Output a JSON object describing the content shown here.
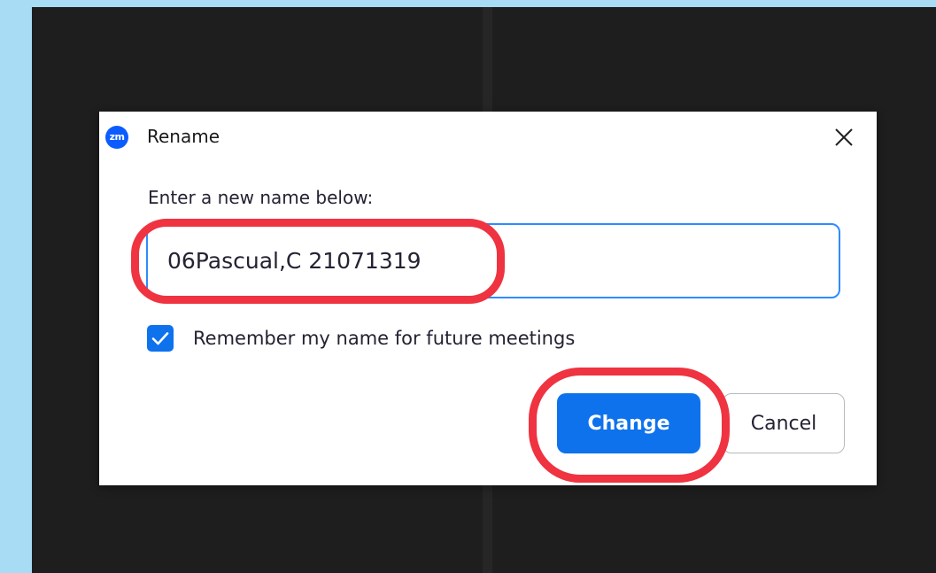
{
  "dialog": {
    "app_logo_text": "zm",
    "title": "Rename",
    "close_icon": "close-icon",
    "prompt": "Enter a new name below:",
    "name_value": "06Pascual,C 21071319",
    "remember_checked": true,
    "remember_label": "Remember my name for future meetings",
    "change_label": "Change",
    "cancel_label": "Cancel"
  },
  "colors": {
    "page_background": "#a8dcf4",
    "video_background": "#1e1e1e",
    "primary": "#0e72ed",
    "input_focus_border": "#2d8cff",
    "highlight": "#ef3340"
  },
  "annotations": {
    "highlighted": [
      "name-input",
      "change-button"
    ]
  }
}
